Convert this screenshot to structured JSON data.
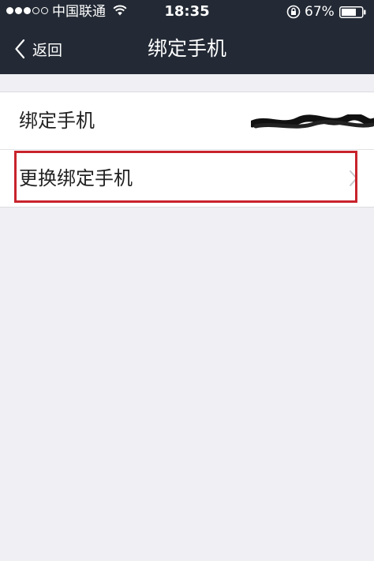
{
  "status_bar": {
    "carrier": "中国联通",
    "time": "18:35",
    "battery_percent": "67%",
    "signal_bars_filled": 3,
    "signal_bars_total": 5,
    "icons": [
      "signal-dots-icon",
      "wifi-icon",
      "orientation-lock-icon",
      "battery-icon"
    ]
  },
  "nav": {
    "back_label": "返回",
    "title": "绑定手机"
  },
  "rows": [
    {
      "label": "绑定手机",
      "value_redacted": true
    },
    {
      "label": "更换绑定手机",
      "has_chevron": true,
      "highlighted": true
    }
  ],
  "colors": {
    "nav_background": "#232a35",
    "page_background": "#efeff4",
    "highlight": "#c8232c"
  }
}
